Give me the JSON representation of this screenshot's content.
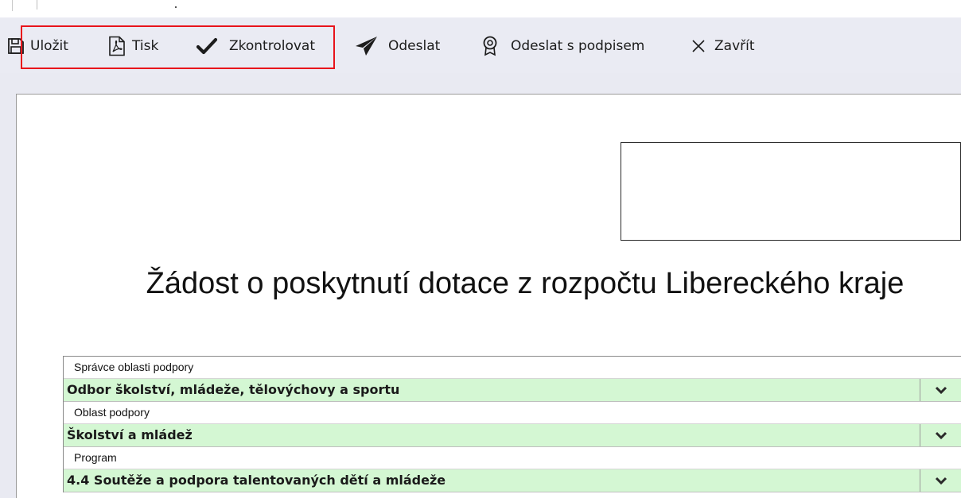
{
  "toolbar": {
    "save": "Uložit",
    "print": "Tisk",
    "check": "Zkontrolovat",
    "send": "Odeslat",
    "send_signed": "Odeslat s podpisem",
    "close": "Zavřít"
  },
  "icons": {
    "save": "floppy-disk-icon",
    "print": "pdf-icon",
    "check": "checkmark-icon",
    "send": "paper-plane-icon",
    "send_signed": "certificate-icon",
    "close": "close-icon",
    "dropdown": "chevron-down-icon"
  },
  "colors": {
    "toolbar_bg": "#eaebf3",
    "highlight": "#e8141b",
    "field_bg": "#d4f7d3"
  },
  "document": {
    "title": "Žádost o poskytnutí dotace z rozpočtu Libereckého kraje",
    "fields": [
      {
        "label": "Správce oblasti podpory",
        "value": "Odbor školství, mládeže, tělovýchovy a sportu"
      },
      {
        "label": "Oblast podpory",
        "value": "Školství a mládež"
      },
      {
        "label": "Program",
        "value": "4.4 Soutěže a podpora talentovaných dětí a mládeže"
      }
    ]
  }
}
